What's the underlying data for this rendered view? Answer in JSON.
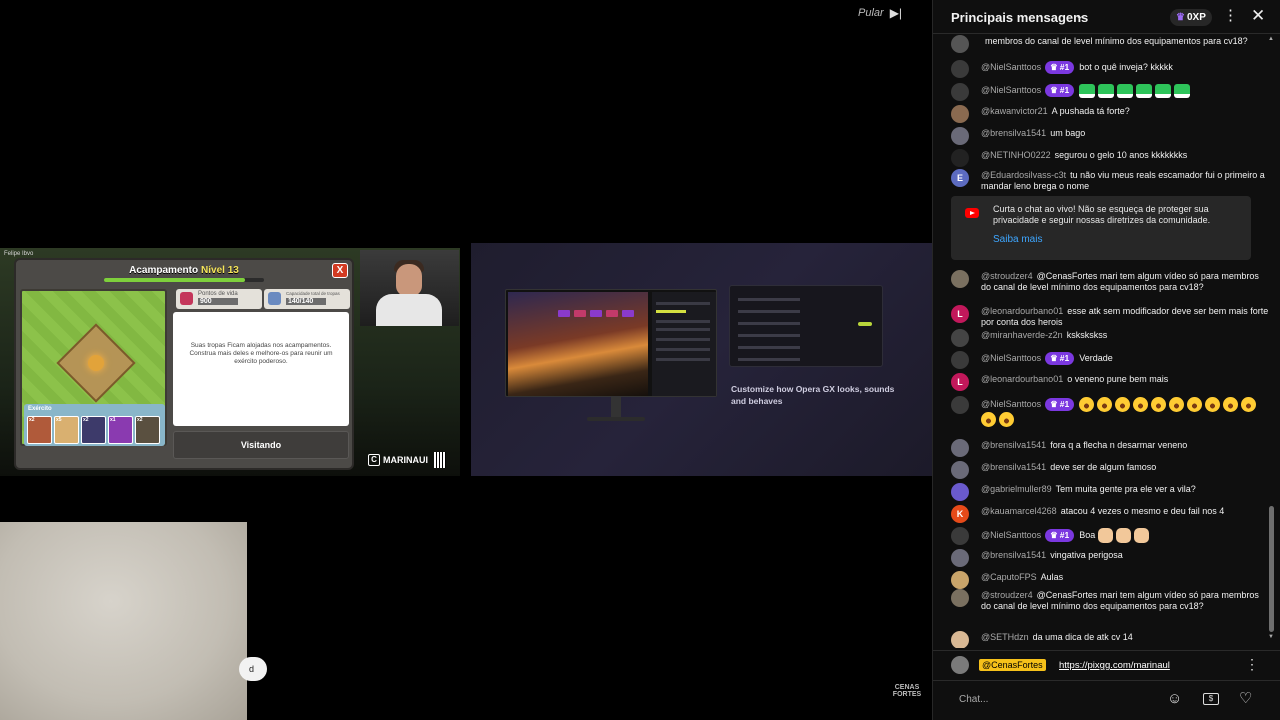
{
  "player": {
    "skip_label": "Pular",
    "skip_icon": "skip-next-icon",
    "game": {
      "streamer_label": "Felipe Ibvo",
      "modal_title": "Acampamento",
      "modal_level": "Nível 13",
      "close": "X",
      "stat_hp_label": "Pontos de vida",
      "stat_hp_value": "900",
      "stat_cap_label": "Capacidade total de tropas",
      "stat_cap_value": "140/140",
      "info_text": "Suas tropas Ficam alojadas nos acampamentos. Construa mais deles e melhore-os para reunir um exército poderoso.",
      "army_label": "Exército",
      "troops": [
        {
          "count": "x2",
          "color": "#b05a3a"
        },
        {
          "count": "x5",
          "color": "#d9b070"
        },
        {
          "count": "x2",
          "color": "#3d3a6a"
        },
        {
          "count": "x1",
          "color": "#8a3ab0"
        },
        {
          "count": "x2",
          "color": "#5a5040"
        }
      ],
      "visit_button": "Visitando",
      "brand": "MARINAUI"
    },
    "ad": {
      "caption": "Customize how Opera GX looks, sounds and behaves"
    },
    "overlay_pill": "d",
    "corner_logo": "CENAS FORTES"
  },
  "chat": {
    "title": "Principais mensagens",
    "xp_badge": "0XP",
    "notice": {
      "text": "Curta o chat ao vivo! Não se esqueça de proteger sua privacidade e seguir nossas diretrizes da comunidade.",
      "link": "Saiba mais"
    },
    "messages": [
      {
        "author": "",
        "text": "membros do canal de level mínimo dos equipamentos para cv18?",
        "avatar": "#555",
        "initial": ""
      },
      {
        "author": "@NielSanttoos",
        "badge": "#1",
        "text": "bot o quê inveja? kkkkk",
        "avatar": "#3a3a3a",
        "initial": ""
      },
      {
        "author": "@NielSanttoos",
        "badge": "#1",
        "text": "",
        "emotes": "frog",
        "emote_count": 6,
        "avatar": "#3a3a3a",
        "initial": ""
      },
      {
        "author": "@kawanvictor21",
        "text": "A pushada tá forte?",
        "avatar": "#8a6a50",
        "initial": ""
      },
      {
        "author": "@brensilva1541",
        "text": "um bago",
        "avatar": "#6a6a78",
        "initial": ""
      },
      {
        "author": "@NETINHO0222",
        "text": "segurou o gelo 10 anos kkkkkkks",
        "avatar": "#222",
        "initial": ""
      },
      {
        "author": "@Eduardosilvass-c3t",
        "text": "tu não viu meus reals escamador fui o primeiro a mandar leno brega o nome",
        "avatar": "#5c6bc0",
        "initial": "E"
      },
      {
        "author": "@stroudzer4",
        "text": "@CenasFortes mari tem algum vídeo só para membros do canal de level mínimo dos equipamentos para cv18?",
        "avatar": "#7a7060",
        "initial": ""
      },
      {
        "author": "@leonardourbano01",
        "text": "esse atk sem modificador deve ser bem mais forte por conta dos herois",
        "avatar": "#c2185b",
        "initial": "L"
      },
      {
        "author": "@miranhaverde-z2n",
        "text": "kskskskss",
        "avatar": "#444",
        "initial": ""
      },
      {
        "author": "@NielSanttoos",
        "badge": "#1",
        "text": "Verdade",
        "avatar": "#3a3a3a",
        "initial": ""
      },
      {
        "author": "@leonardourbano01",
        "text": "o veneno pune bem mais",
        "avatar": "#c2185b",
        "initial": "L"
      },
      {
        "author": "@NielSanttoos",
        "badge": "#1",
        "text": "",
        "emotes": "rofl",
        "emote_count": 12,
        "avatar": "#3a3a3a",
        "initial": ""
      },
      {
        "author": "@brensilva1541",
        "text": "fora q a flecha n desarmar veneno",
        "avatar": "#6a6a78",
        "initial": ""
      },
      {
        "author": "@brensilva1541",
        "text": "deve ser de algum famoso",
        "avatar": "#6a6a78",
        "initial": ""
      },
      {
        "author": "@gabrielmuller89",
        "text": "Tem muita gente pra ele ver a vila?",
        "avatar": "#6a5acd",
        "initial": ""
      },
      {
        "author": "@kauamarcel4268",
        "text": "atacou 4 vezes o mesmo e deu fail nos 4",
        "avatar": "#e64a19",
        "initial": "K"
      },
      {
        "author": "@NielSanttoos",
        "badge": "#1",
        "text": "Boa",
        "emotes": "clap",
        "emote_count": 3,
        "avatar": "#3a3a3a",
        "initial": ""
      },
      {
        "author": "@brensilva1541",
        "text": "vingativa perigosa",
        "avatar": "#6a6a78",
        "initial": ""
      },
      {
        "author": "@CaputoFPS",
        "text": "Aulas",
        "avatar": "#c9a46a",
        "initial": ""
      },
      {
        "author": "@stroudzer4",
        "text": "@CenasFortes mari tem algum vídeo só para membros do canal de level mínimo dos equipamentos para cv18?",
        "avatar": "#7a7060",
        "initial": ""
      },
      {
        "author": "@SETHdzn",
        "text": "da uma dica de atk cv 14",
        "avatar": "#d8b894",
        "initial": ""
      }
    ],
    "pinned": {
      "tag": "@CenasFortes",
      "url": "https://pixgg.com/marinaul"
    },
    "input_placeholder": "Chat..."
  }
}
